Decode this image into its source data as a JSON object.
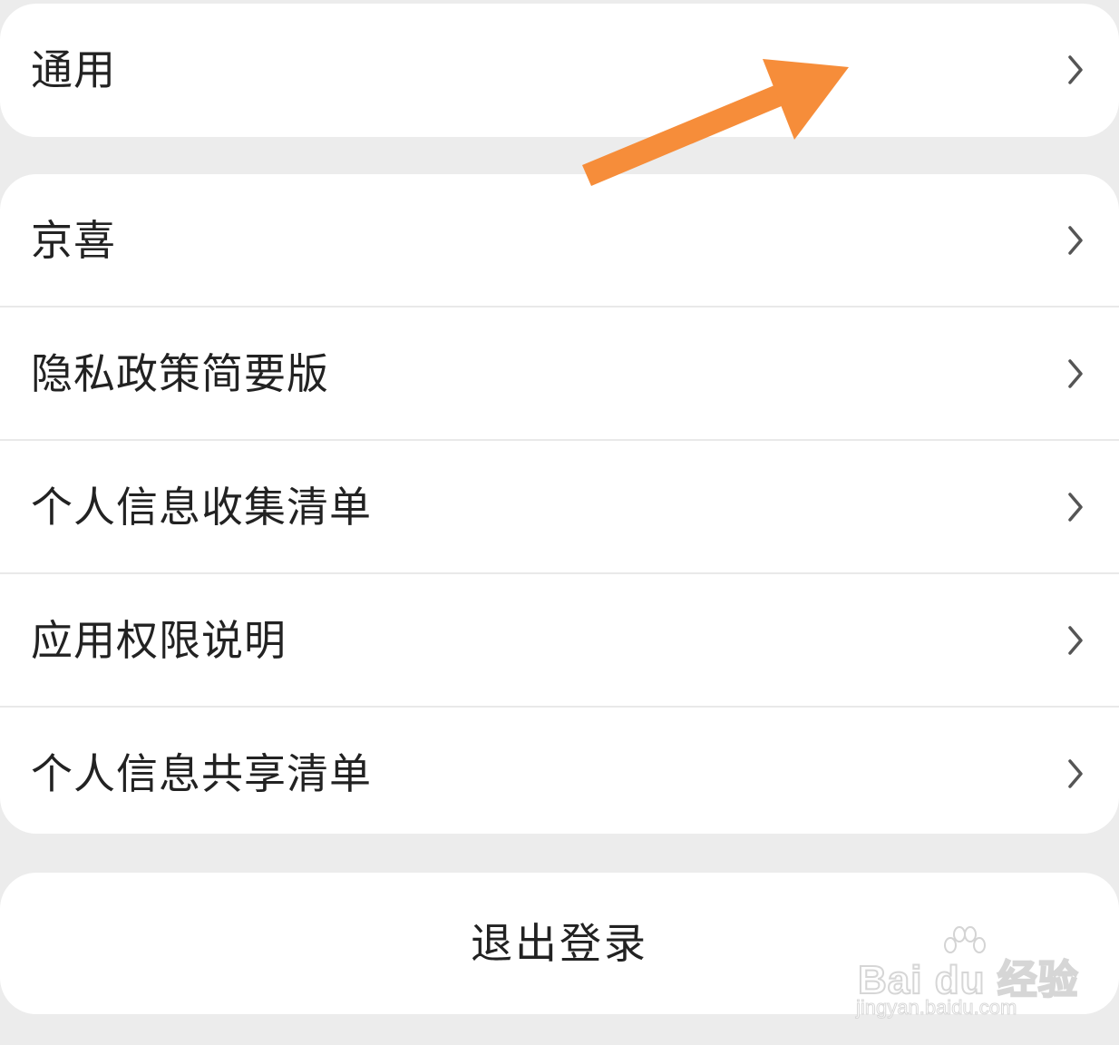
{
  "settings": {
    "general": {
      "label": "通用",
      "icon": "chevron-right-icon"
    },
    "items": [
      {
        "label": "京喜",
        "icon": "chevron-right-icon"
      },
      {
        "label": "隐私政策简要版",
        "icon": "chevron-right-icon"
      },
      {
        "label": "个人信息收集清单",
        "icon": "chevron-right-icon"
      },
      {
        "label": "应用权限说明",
        "icon": "chevron-right-icon"
      },
      {
        "label": "个人信息共享清单",
        "icon": "chevron-right-icon"
      }
    ],
    "logout_label": "退出登录"
  },
  "annotation": {
    "icon": "arrow-icon",
    "color": "#f68d3a"
  },
  "watermark": {
    "brand": "Bai du 经验",
    "url": "jingyan.baidu.com"
  },
  "colors": {
    "background": "#ececec",
    "card": "#ffffff",
    "text": "#222222",
    "chevron": "#555555",
    "divider": "#e9e9e9"
  }
}
